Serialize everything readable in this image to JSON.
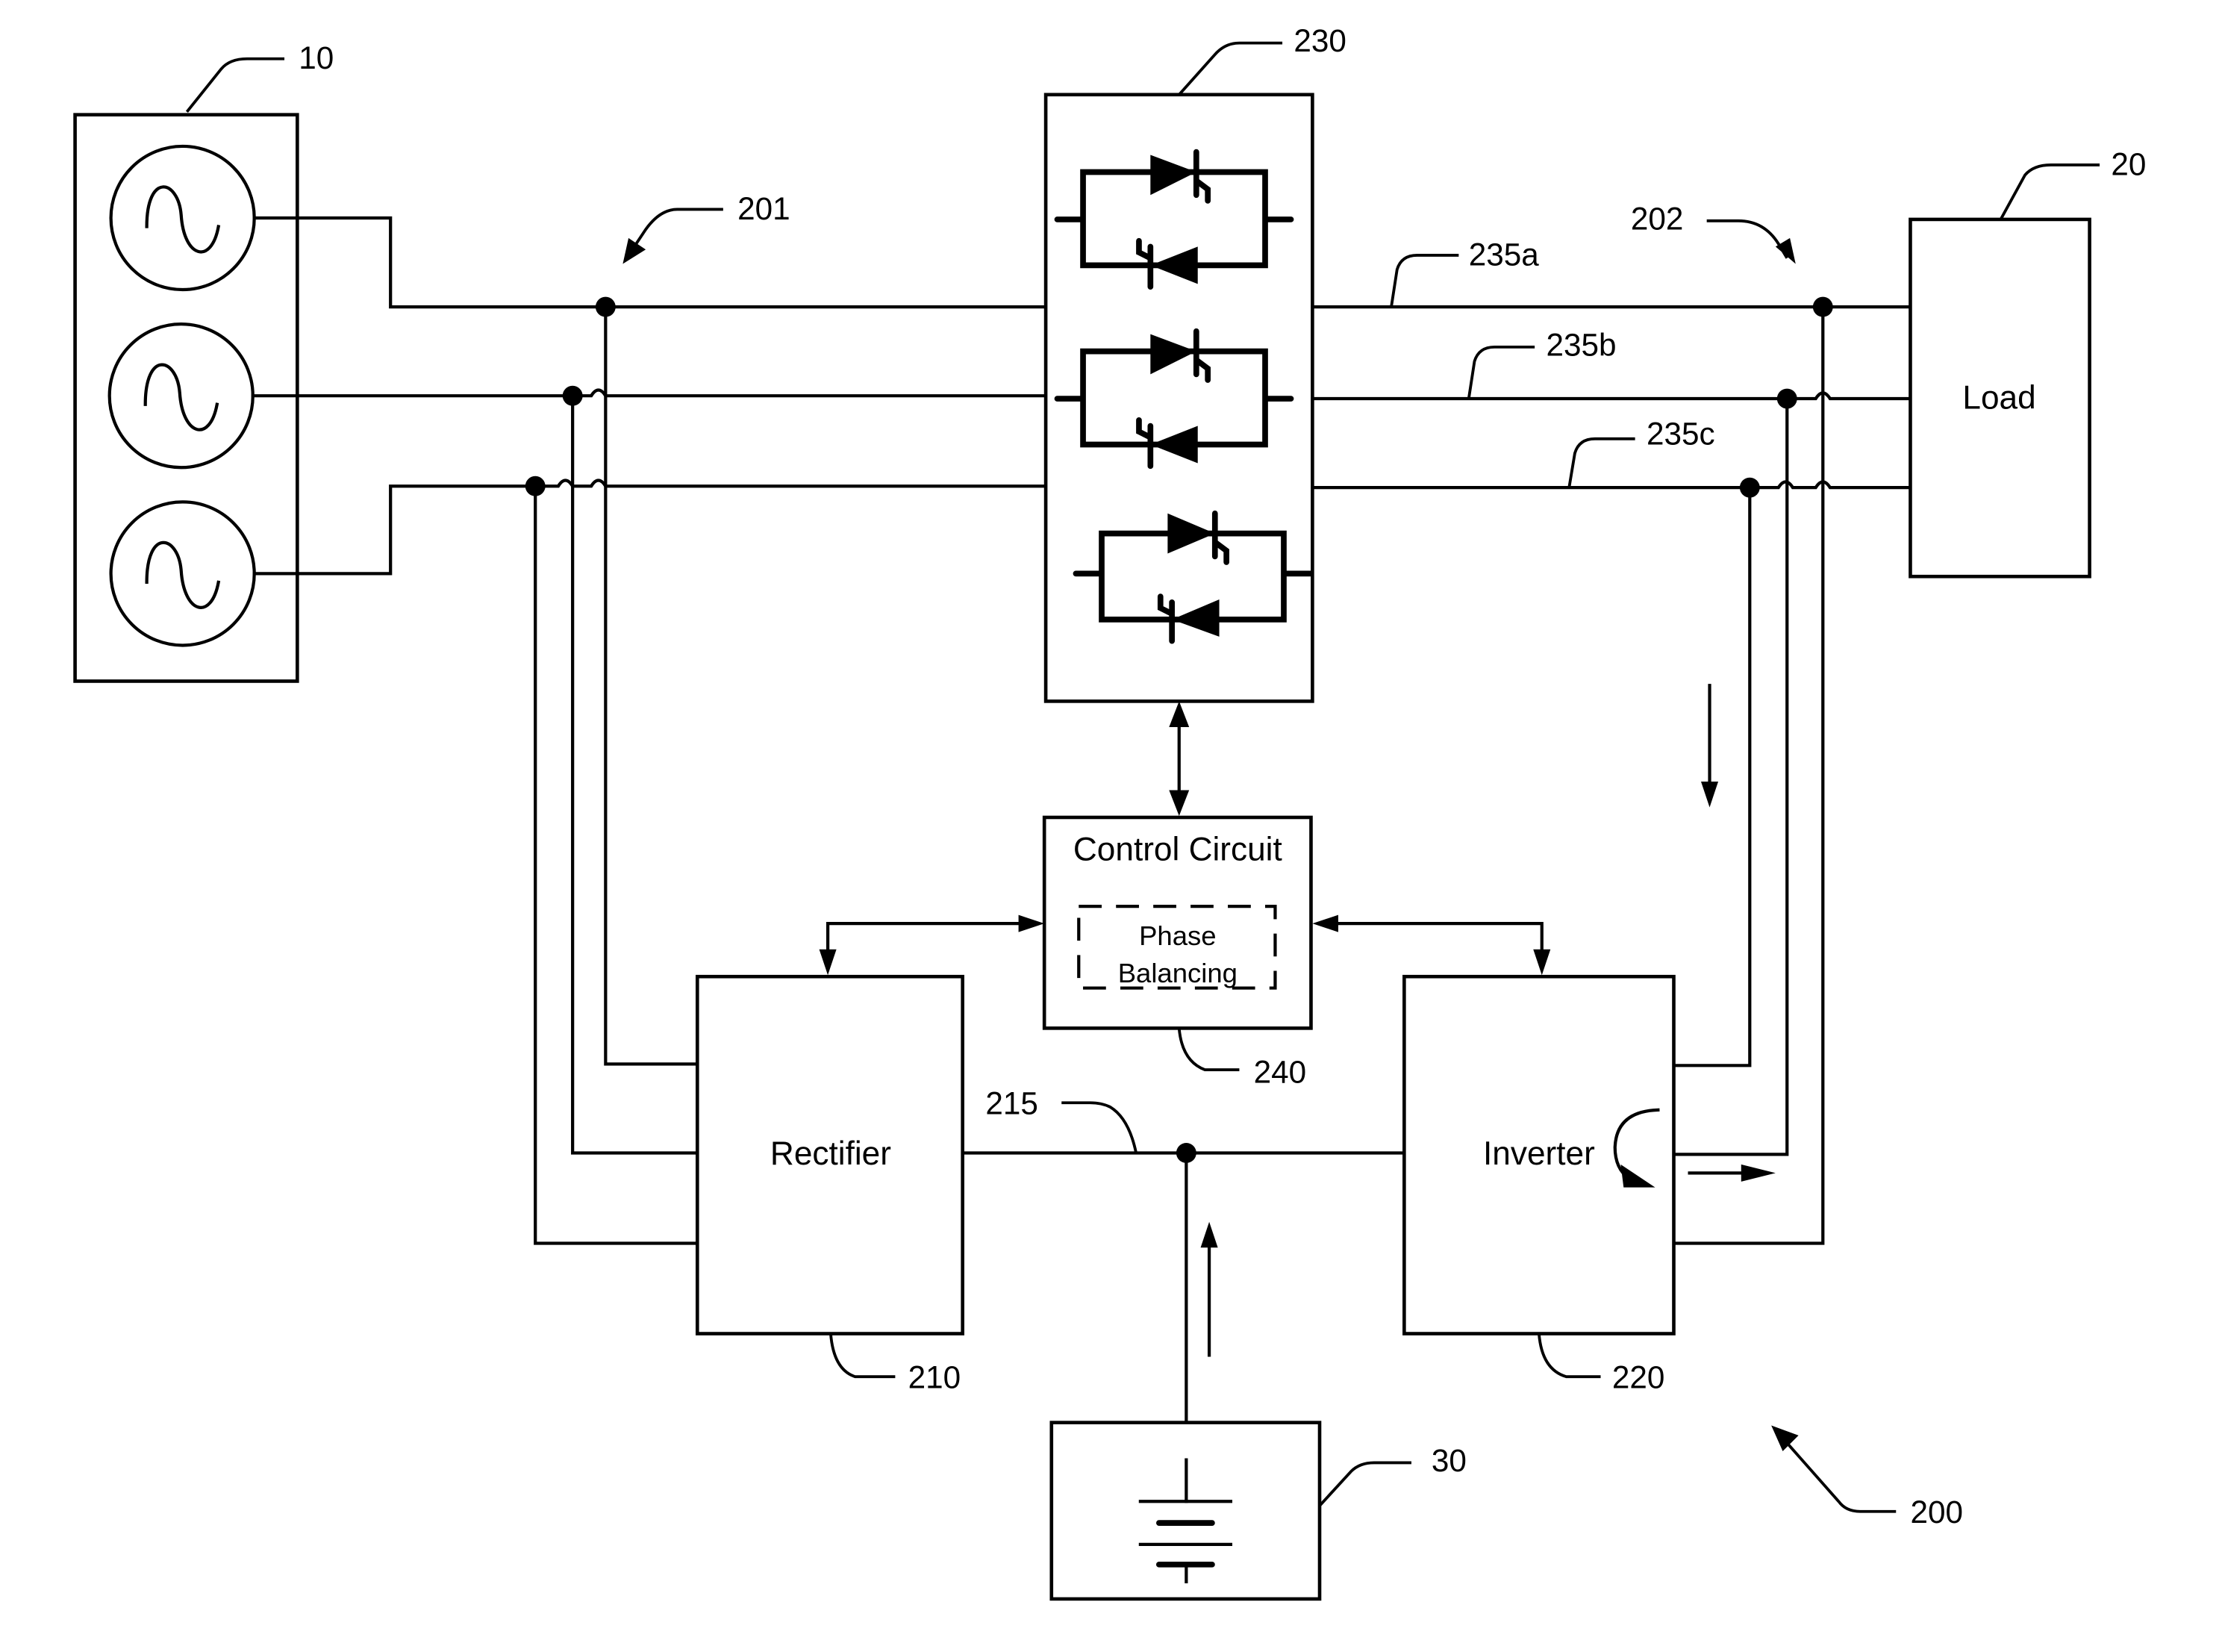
{
  "figure": {
    "type": "circuit block diagram",
    "system_ref": "200"
  },
  "components": {
    "source": {
      "ref": "10",
      "phases": 3,
      "icon": "ac-source-icon"
    },
    "load": {
      "ref": "20",
      "label": "Load"
    },
    "battery": {
      "ref": "30",
      "icon": "battery-icon"
    },
    "input_node": {
      "ref": "201"
    },
    "output_node": {
      "ref": "202"
    },
    "rectifier": {
      "ref": "210",
      "label": "Rectifier"
    },
    "dc_bus": {
      "ref": "215"
    },
    "inverter": {
      "ref": "220",
      "label": "Inverter"
    },
    "static_switch": {
      "ref": "230",
      "icon": "thyristor-pair-icon",
      "count": 3
    },
    "control_circuit": {
      "ref": "240",
      "label": "Control Circuit",
      "sub_block": "Phase Balancing",
      "sub_label_line1": "Phase",
      "sub_label_line2": "Balancing"
    },
    "output_lines": [
      {
        "ref": "235a"
      },
      {
        "ref": "235b"
      },
      {
        "ref": "235c"
      }
    ]
  },
  "colors": {
    "ink": "#000000",
    "paper": "#ffffff"
  }
}
